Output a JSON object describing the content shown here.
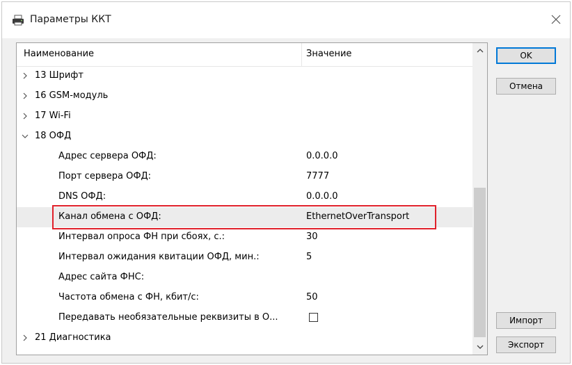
{
  "window": {
    "title": "Параметры ККТ"
  },
  "grid": {
    "headers": {
      "name": "Наименование",
      "value": "Значение"
    },
    "rows": [
      {
        "kind": "group",
        "expanded": false,
        "label": "13 Шрифт"
      },
      {
        "kind": "group",
        "expanded": false,
        "label": "16 GSM-модуль"
      },
      {
        "kind": "group",
        "expanded": false,
        "label": "17 Wi-Fi"
      },
      {
        "kind": "group",
        "expanded": true,
        "label": "18 ОФД"
      },
      {
        "kind": "prop",
        "label": "Адрес сервера ОФД:",
        "value": "0.0.0.0"
      },
      {
        "kind": "prop",
        "label": "Порт сервера ОФД:",
        "value": "7777"
      },
      {
        "kind": "prop",
        "label": "DNS ОФД:",
        "value": "0.0.0.0"
      },
      {
        "kind": "prop",
        "label": "Канал обмена с ОФД:",
        "value": "EthernetOverTransport",
        "selected": true
      },
      {
        "kind": "prop",
        "label": "Интервал опроса ФН при сбоях, с.:",
        "value": "30"
      },
      {
        "kind": "prop",
        "label": "Интервал ожидания квитации ОФД, мин.:",
        "value": "5"
      },
      {
        "kind": "prop",
        "label": "Адрес сайта ФНС:",
        "value": ""
      },
      {
        "kind": "prop",
        "label": "Частота обмена с ФН, кбит/с:",
        "value": "50"
      },
      {
        "kind": "prop",
        "label": "Передавать необязательные реквизиты в О...",
        "value": "",
        "checkbox": true,
        "checked": false
      },
      {
        "kind": "group",
        "expanded": false,
        "label": "21 Диагностика"
      }
    ]
  },
  "buttons": {
    "ok": "OK",
    "cancel": "Отмена",
    "import": "Импорт",
    "export": "Экспорт"
  },
  "icons": {
    "title": "printer-icon",
    "close": "close-icon",
    "collapsed": "chevron-right-icon",
    "expanded": "chevron-down-icon"
  },
  "colors": {
    "highlight": "#e0202a",
    "default_button_border": "#0078d7"
  }
}
